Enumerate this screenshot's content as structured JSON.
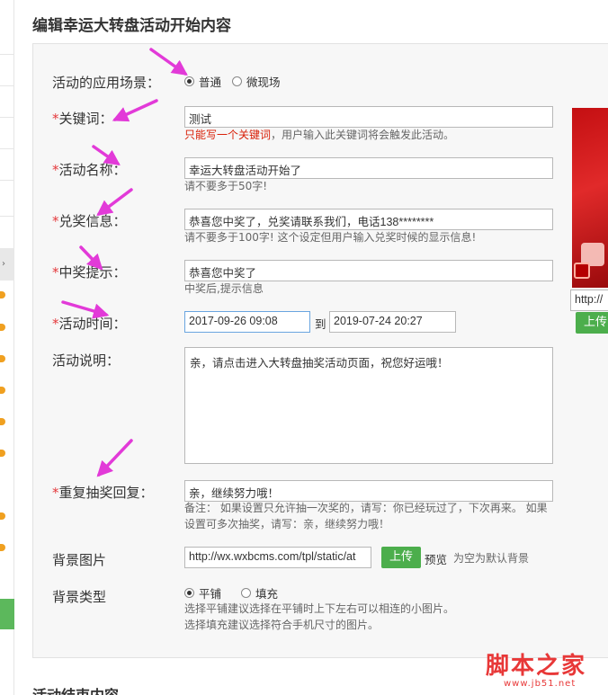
{
  "page_title": "编辑幸运大转盘活动开始内容",
  "footer_title": "活动结束内容",
  "form": {
    "scene_label": "活动的应用场景：",
    "scene_options": [
      "普通",
      "微现场"
    ],
    "keyword_label": "关键词：",
    "keyword_value": "测试",
    "keyword_hint_red": "只能写一个关键词",
    "keyword_hint_rest": "，用户输入此关键词将会触发此活动。",
    "name_label": "活动名称：",
    "name_value": "幸运大转盘活动开始了",
    "name_hint": "请不要多于50字!",
    "prize_label": "兑奖信息：",
    "prize_value": "恭喜您中奖了，兑奖请联系我们，电话138********",
    "prize_hint": "请不要多于100字! 这个设定但用户输入兑奖时候的显示信息!",
    "win_label": "中奖提示：",
    "win_value": "恭喜您中奖了",
    "win_hint": "中奖后,提示信息",
    "time_label": "活动时间：",
    "time_start": "2017-09-26 09:08",
    "time_to": "到",
    "time_end": "2019-07-24 20:27",
    "desc_label": "活动说明：",
    "desc_value": "亲，请点击进入大转盘抽奖活动页面，祝您好运哦！",
    "repeat_label": "重复抽奖回复：",
    "repeat_value": "亲，继续努力哦！",
    "repeat_hint_1": "备注： 如果设置只允许抽一次奖的，请写：你已经玩过了，下次再来。 如果",
    "repeat_hint_2": "设置可多次抽奖，请写：亲，继续努力哦！",
    "bg_label": "背景图片",
    "bg_value": "http://wx.wxbcms.com/tpl/static/at",
    "upload_label": "上传",
    "preview_label": "预览",
    "bg_default_hint": "为空为默认背景",
    "bgtype_label": "背景类型",
    "bgtype_options": [
      "平铺",
      "填充"
    ],
    "bgtype_hint_1": "选择平铺建议选择在平铺时上下左右可以相连的小图片。",
    "bgtype_hint_2": "选择填充建议选择符合手机尺寸的图片。",
    "required_mark": "*"
  },
  "side": {
    "url_value": "http://",
    "upload_label": "上传"
  },
  "watermark": {
    "big": "脚本之家",
    "small": "www.jb51.net"
  },
  "colors": {
    "accent_green": "#4cae4c",
    "required_red": "#e4393c",
    "arrow_magenta": "#e23ad8"
  }
}
